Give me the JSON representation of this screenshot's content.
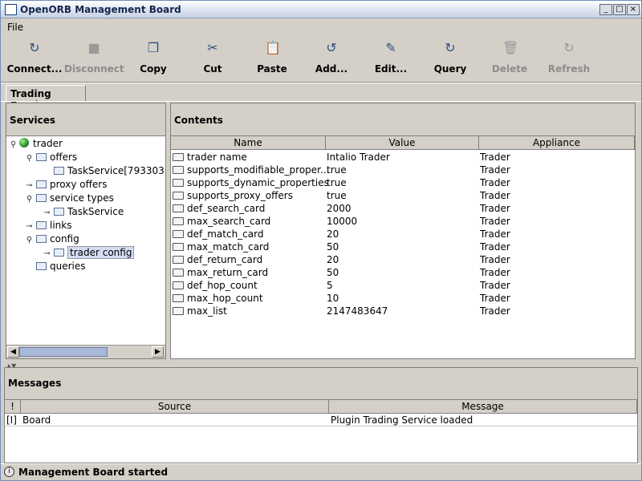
{
  "window": {
    "title": "OpenORB Management Board",
    "minimize": "_",
    "maximize": "□",
    "close": "×"
  },
  "menu": {
    "file": "File"
  },
  "toolbar": [
    {
      "label": "Connect...",
      "icon": "connect-icon",
      "glyph": "↻",
      "enabled": true
    },
    {
      "label": "Disconnect",
      "icon": "disconnect-icon",
      "glyph": "■",
      "enabled": false
    },
    {
      "label": "Copy",
      "icon": "copy-icon",
      "glyph": "❐",
      "enabled": true
    },
    {
      "label": "Cut",
      "icon": "scissors-icon",
      "glyph": "✂",
      "enabled": true
    },
    {
      "label": "Paste",
      "icon": "paste-icon",
      "glyph": "📋",
      "enabled": true
    },
    {
      "label": "Add...",
      "icon": "add-icon",
      "glyph": "↺",
      "enabled": true
    },
    {
      "label": "Edit...",
      "icon": "edit-icon",
      "glyph": "✎",
      "enabled": true
    },
    {
      "label": "Query",
      "icon": "query-icon",
      "glyph": "↻",
      "enabled": true
    },
    {
      "label": "Delete",
      "icon": "trash-icon",
      "glyph": "🗑",
      "enabled": false
    },
    {
      "label": "Refresh",
      "icon": "refresh-icon",
      "glyph": "↻",
      "enabled": false
    }
  ],
  "tab": {
    "label": "Trading Service"
  },
  "services": {
    "title": "Services",
    "tree": [
      {
        "label": "trader",
        "control": "⚲",
        "type": "globe"
      },
      {
        "label": "offers",
        "control": "⚲",
        "type": "folder"
      },
      {
        "label": "TaskService[793303",
        "control": "",
        "type": "folder"
      },
      {
        "label": "proxy offers",
        "control": "⊸",
        "type": "folder"
      },
      {
        "label": "service types",
        "control": "⚲",
        "type": "folder"
      },
      {
        "label": "TaskService",
        "control": "⊸",
        "type": "folder"
      },
      {
        "label": "links",
        "control": "⊸",
        "type": "folder"
      },
      {
        "label": "config",
        "control": "⚲",
        "type": "folder"
      },
      {
        "label": "trader config",
        "control": "⊸",
        "type": "folder",
        "selected": true
      },
      {
        "label": "queries",
        "control": "",
        "type": "folder"
      }
    ],
    "scroll_left": "◀",
    "scroll_right": "▶"
  },
  "contents": {
    "title": "Contents",
    "columns": [
      "Name",
      "Value",
      "Appliance"
    ],
    "rows": [
      [
        "trader name",
        "Intalio Trader",
        "Trader"
      ],
      [
        "supports_modifiable_proper...",
        "true",
        "Trader"
      ],
      [
        "supports_dynamic_properties",
        "true",
        "Trader"
      ],
      [
        "supports_proxy_offers",
        "true",
        "Trader"
      ],
      [
        "def_search_card",
        "2000",
        "Trader"
      ],
      [
        "max_search_card",
        "10000",
        "Trader"
      ],
      [
        "def_match_card",
        "20",
        "Trader"
      ],
      [
        "max_match_card",
        "50",
        "Trader"
      ],
      [
        "def_return_card",
        "20",
        "Trader"
      ],
      [
        "max_return_card",
        "50",
        "Trader"
      ],
      [
        "def_hop_count",
        "5",
        "Trader"
      ],
      [
        "max_hop_count",
        "10",
        "Trader"
      ],
      [
        "max_list",
        "2147483647",
        "Trader"
      ]
    ]
  },
  "messages": {
    "title": "Messages",
    "columns": [
      "!",
      "Source",
      "Message"
    ],
    "rows": [
      [
        "[I]",
        "Board",
        "Plugin Trading Service loaded"
      ]
    ]
  },
  "status": {
    "text": "Management Board started",
    "icon": "info-icon"
  }
}
